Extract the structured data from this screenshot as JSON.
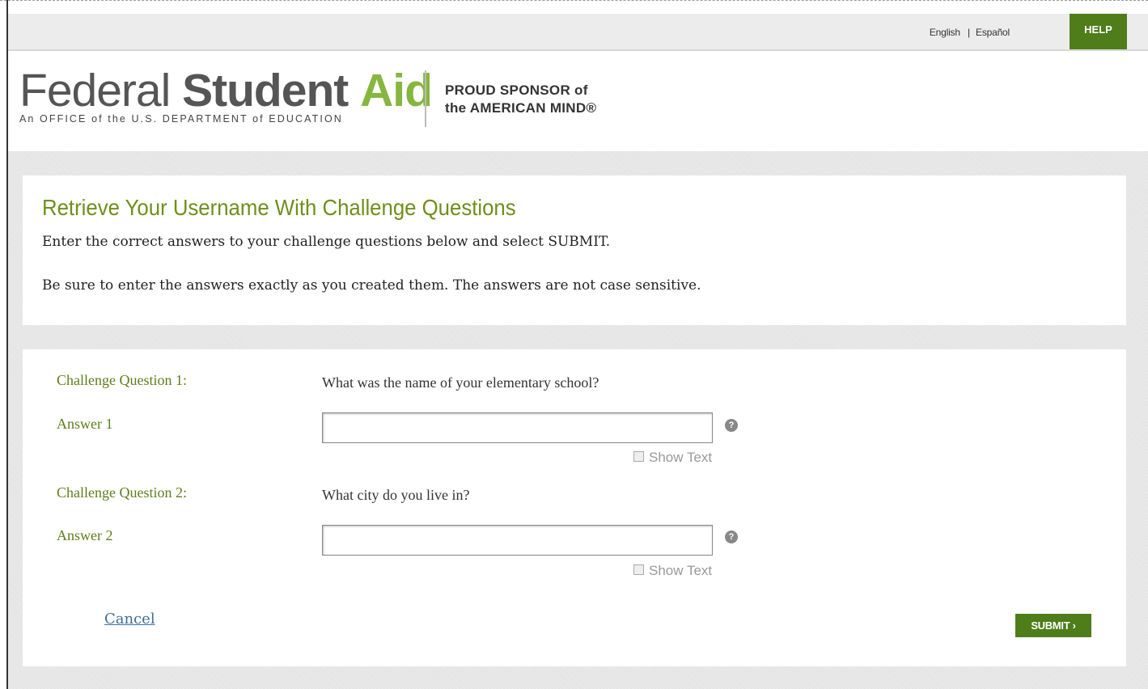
{
  "topbar": {
    "lang_english": "English",
    "lang_separator": "|",
    "lang_spanish": "Español",
    "help_label": "HELP"
  },
  "logo": {
    "word1": "Federal",
    "word2": "Student",
    "word3": "Aid",
    "subtitle": "An OFFICE of the U.S. DEPARTMENT of EDUCATION",
    "sponsor_line1": "PROUD SPONSOR of",
    "sponsor_line2": "the AMERICAN MIND®"
  },
  "intro": {
    "title": "Retrieve Your Username With Challenge Questions",
    "line1": "Enter the correct answers to your challenge questions below and select SUBMIT.",
    "line2": "Be sure to enter the answers exactly as you created them. The answers are not case sensitive."
  },
  "form": {
    "q1_label": "Challenge Question 1:",
    "q1_text": "What was the name of your elementary school?",
    "a1_label": "Answer 1",
    "a1_value": "",
    "q2_label": "Challenge Question 2:",
    "q2_text": "What city do you live in?",
    "a2_label": "Answer 2",
    "a2_value": "",
    "show_text": "Show Text",
    "help_glyph": "?",
    "cancel": "Cancel",
    "submit": "SUBMIT ›"
  },
  "colors": {
    "brand_green": "#4e7d1a",
    "title_green": "#6f8f1b",
    "logo_green": "#86b63f",
    "link_blue": "#3d6f99"
  }
}
